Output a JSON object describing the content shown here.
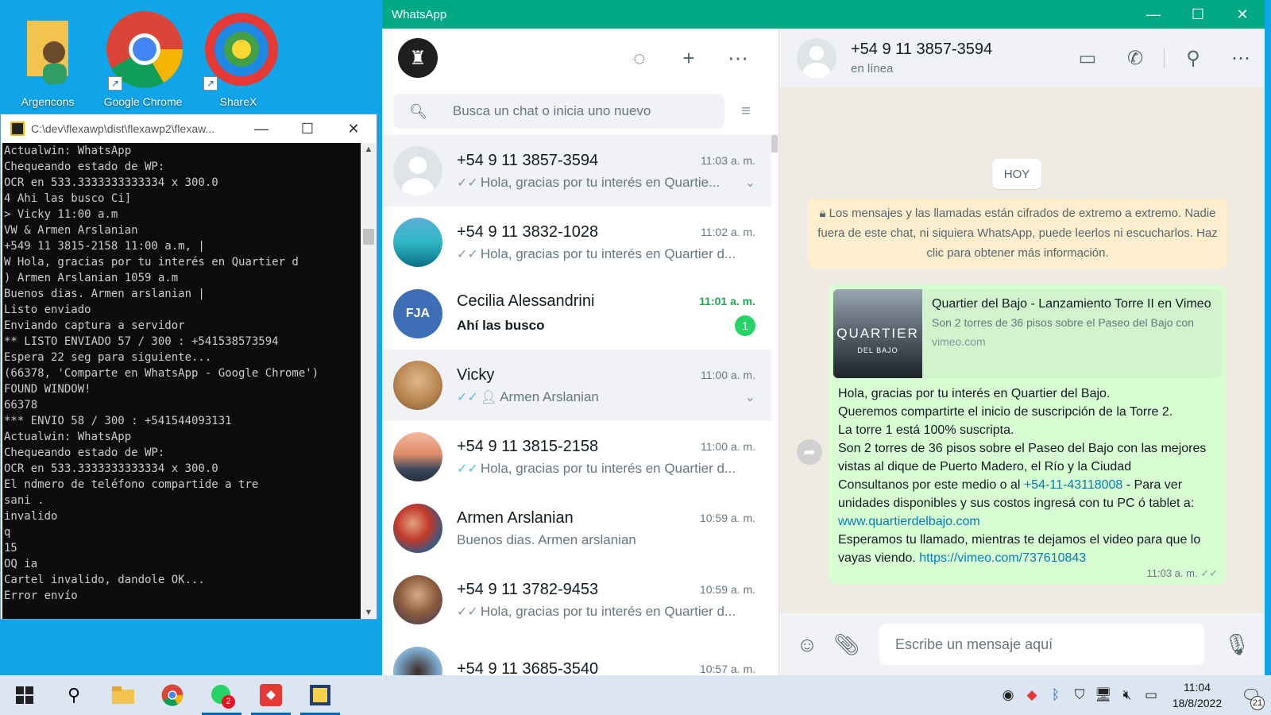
{
  "desktop": {
    "icons": [
      {
        "label": "Argencons"
      },
      {
        "label": "Google Chrome"
      },
      {
        "label": "ShareX"
      }
    ]
  },
  "console": {
    "title": "C:\\dev\\flexawp\\dist\\flexawp2\\flexaw...",
    "lines": [
      "Actualwin: WhatsApp",
      "Chequeando estado de WP:",
      "OCR en 533.3333333333334 x 300.0",
      "4 Ahi las busco Ci]",
      "> Vicky 11:00 a.m",
      "VW & Armen Arslanian",
      "+549 11 3815-2158 11:00 a.m, |",
      "W Hola, gracias por tu interés en Quartier d",
      ") Armen Arslanian 1059 a.m",
      "Buenos dias. Armen arslanian |",
      "Listo enviado",
      "Enviando captura a servidor",
      "** LISTO ENVIADO 57 / 300 : +541538573594",
      "Espera 22 seg para siguiente...",
      "(66378, 'Comparte en WhatsApp - Google Chrome')",
      "FOUND WINDOW!",
      "66378",
      "*** ENVIO 58 / 300 : +541544093131",
      "Actualwin: WhatsApp",
      "Chequeando estado de WP:",
      "OCR en 533.3333333333334 x 300.0",
      "El ndmero de teléfono compartide a tre",
      "sani .",
      "invalido",
      "q",
      "15",
      "OQ ia",
      "Cartel invalido, dandole OK...",
      "Error envío"
    ]
  },
  "whatsapp": {
    "title": "WhatsApp",
    "search_placeholder": "Busca un chat o inicia uno nuevo",
    "chats": [
      {
        "name": "+54 9 11 3857-3594",
        "time": "11:03 a. m.",
        "preview": "Hola, gracias por tu interés en Quartie...",
        "ticks": "✓✓",
        "ticks_read": false
      },
      {
        "name": "+54 9 11 3832-1028",
        "time": "11:02 a. m.",
        "preview": "Hola, gracias por tu interés en Quartier d...",
        "ticks": "✓✓",
        "ticks_read": false
      },
      {
        "name": "Cecilia Alessandrini",
        "avatar_text": "FJA",
        "time": "11:01 a. m.",
        "preview": "Ahí las busco",
        "unread": "1"
      },
      {
        "name": "Vicky",
        "time": "11:00 a. m.",
        "preview": "Armen Arslanian",
        "ticks": "✓✓",
        "ticks_read": true
      },
      {
        "name": "+54 9 11 3815-2158",
        "time": "11:00 a. m.",
        "preview": "Hola, gracias por tu interés en Quartier d...",
        "ticks": "✓✓",
        "ticks_read": true
      },
      {
        "name": "Armen Arslanian",
        "time": "10:59 a. m.",
        "preview": "Buenos dias.  Armen arslanian"
      },
      {
        "name": "+54 9 11 3782-9453",
        "time": "10:59 a. m.",
        "preview": "Hola, gracias por tu interés en Quartier d...",
        "ticks": "✓✓",
        "ticks_read": false
      },
      {
        "name": "+54 9 11 3685-3540",
        "time": "10:57 a. m.",
        "preview": ""
      }
    ],
    "conversation": {
      "contact_name": "+54 9 11 3857-3594",
      "contact_status": "en línea",
      "day_chip": "HOY",
      "encryption_notice": "Los mensajes y las llamadas están cifrados de extremo a extremo. Nadie fuera de este chat, ni siquiera WhatsApp, puede leerlos ni escucharlos. Haz clic para obtener más información.",
      "link_preview": {
        "title": "Quartier del Bajo - Lanzamiento Torre II en Vimeo",
        "description": "Son 2 torres de 36 pisos sobre el Paseo del Bajo con",
        "domain": "vimeo.com",
        "thumb_text": "QUARTIER",
        "thumb_sub": "DEL BAJO"
      },
      "message": {
        "p1": "Hola, gracias por tu interés en Quartier del Bajo.",
        "p2": "Queremos compartirte el inicio de suscripción de la Torre 2.",
        "p3": "La torre 1 está 100% suscripta.",
        "p4": "Son 2 torres de 36 pisos sobre el Paseo del Bajo con las mejores vistas al dique de Puerto Madero, el Río y la Ciudad",
        "p5_pre": "Consultanos por este medio o al ",
        "phone_link": "+54-11-43118008",
        "p5_post": " - Para ver unidades disponibles y sus costos ingresá con tu PC ó tablet a: ",
        "web_link": "www.quartierdelbajo.com",
        "p6": "Esperamos tu llamado, mientras te dejamos el video para que lo vayas viendo. ",
        "video_link": "https://vimeo.com/737610843",
        "time": "11:03 a. m."
      },
      "composer_placeholder": "Escribe un mensaje aquí"
    }
  },
  "taskbar": {
    "clock_time": "11:04",
    "clock_date": "18/8/2022",
    "whatsapp_badge": "2",
    "notifications": "21"
  }
}
